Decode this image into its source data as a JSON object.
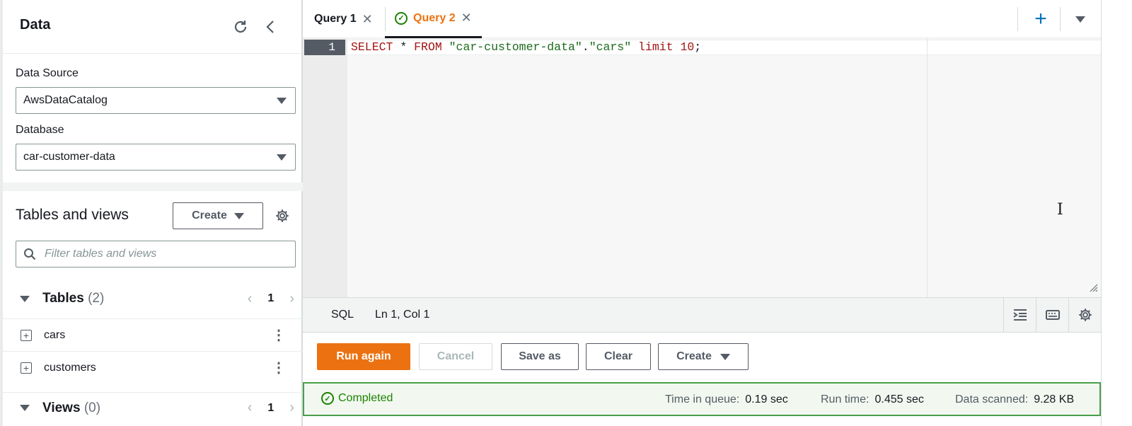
{
  "panel": {
    "title": "Data",
    "data_source_label": "Data Source",
    "data_source_value": "AwsDataCatalog",
    "database_label": "Database",
    "database_value": "car-customer-data",
    "tables_views_title": "Tables and views",
    "create_label": "Create",
    "filter_placeholder": "Filter tables and views",
    "tables_label": "Tables",
    "tables_count": "(2)",
    "tables_page": "1",
    "tables": [
      {
        "name": "cars"
      },
      {
        "name": "customers"
      }
    ],
    "views_label": "Views",
    "views_count": "(0)",
    "views_page": "1"
  },
  "tabs": [
    {
      "label": "Query 1",
      "active": false
    },
    {
      "label": "Query 2",
      "active": true
    }
  ],
  "editor": {
    "line_number": "1",
    "tokens": {
      "select": "SELECT",
      "star": " * ",
      "from": "FROM",
      "space1": " ",
      "db": "\"car-customer-data\"",
      "dot": ".",
      "table": "\"cars\"",
      "space2": " ",
      "limit": "limit",
      "space3": " ",
      "num": "10",
      "semi": ";"
    }
  },
  "status": {
    "language": "SQL",
    "position": "Ln 1, Col 1"
  },
  "actions": {
    "run": "Run again",
    "cancel": "Cancel",
    "save_as": "Save as",
    "clear": "Clear",
    "create": "Create"
  },
  "result": {
    "state": "Completed",
    "queue_label": "Time in queue:",
    "queue_value": "0.19 sec",
    "runtime_label": "Run time:",
    "runtime_value": "0.455 sec",
    "scanned_label": "Data scanned:",
    "scanned_value": "9.28 KB"
  },
  "colors": {
    "accent": "#ec7211",
    "success": "#1d8102"
  }
}
